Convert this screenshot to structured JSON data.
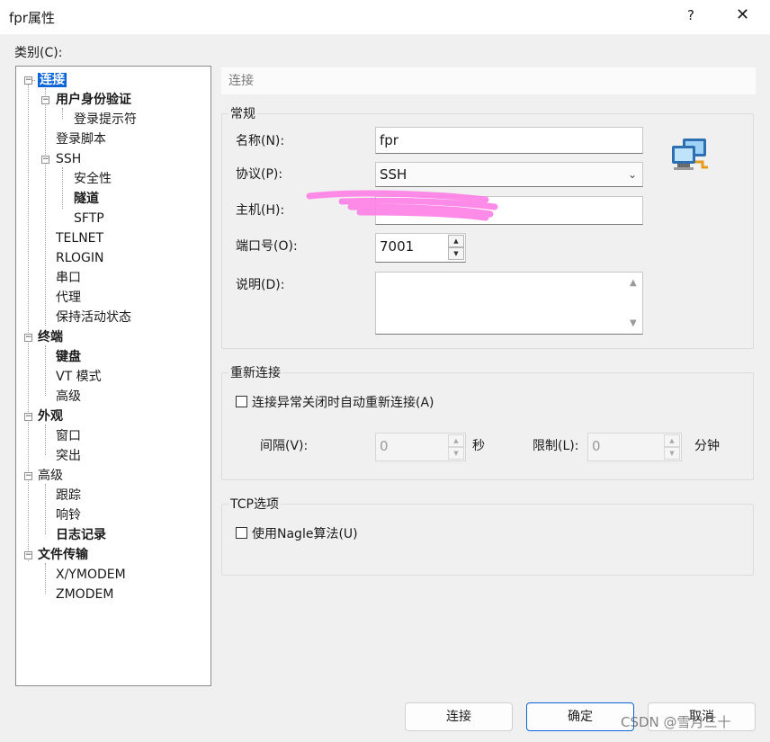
{
  "window": {
    "title": "fpr属性",
    "help": "?",
    "close": "✕"
  },
  "category_label": "类别(C):",
  "tree": {
    "items": [
      {
        "label": "连接"
      },
      {
        "label": "用户身份验证"
      },
      {
        "label": "登录提示符"
      },
      {
        "label": "登录脚本"
      },
      {
        "label": "SSH"
      },
      {
        "label": "安全性"
      },
      {
        "label": "隧道"
      },
      {
        "label": "SFTP"
      },
      {
        "label": "TELNET"
      },
      {
        "label": "RLOGIN"
      },
      {
        "label": "串口"
      },
      {
        "label": "代理"
      },
      {
        "label": "保持活动状态"
      },
      {
        "label": "终端"
      },
      {
        "label": "键盘"
      },
      {
        "label": "VT 模式"
      },
      {
        "label": "高级"
      },
      {
        "label": "外观"
      },
      {
        "label": "窗口"
      },
      {
        "label": "突出"
      },
      {
        "label": "高级"
      },
      {
        "label": "跟踪"
      },
      {
        "label": "响铃"
      },
      {
        "label": "日志记录"
      },
      {
        "label": "文件传输"
      },
      {
        "label": "X/YMODEM"
      },
      {
        "label": "ZMODEM"
      }
    ]
  },
  "header": "连接",
  "general": {
    "title": "常规",
    "name_label": "名称(N):",
    "name_value": "fpr",
    "protocol_label": "协议(P):",
    "protocol_value": "SSH",
    "host_label": "主机(H):",
    "host_value": "",
    "port_label": "端口号(O):",
    "port_value": "7001",
    "desc_label": "说明(D):",
    "desc_value": ""
  },
  "reconnect": {
    "title": "重新连接",
    "checkbox_label": "连接异常关闭时自动重新连接(A)",
    "checked": false,
    "interval_label": "间隔(V):",
    "interval_value": "0",
    "interval_unit": "秒",
    "limit_label": "限制(L):",
    "limit_value": "0",
    "limit_unit": "分钟"
  },
  "tcp": {
    "title": "TCP选项",
    "nagle_label": "使用Nagle算法(U)",
    "checked": false
  },
  "buttons": {
    "connect": "连接",
    "ok": "确定",
    "cancel": "取消"
  },
  "watermark": "CSDN @雪月三十",
  "colors": {
    "selection": "#0a64d8",
    "scribble": "#ff7ee6"
  }
}
